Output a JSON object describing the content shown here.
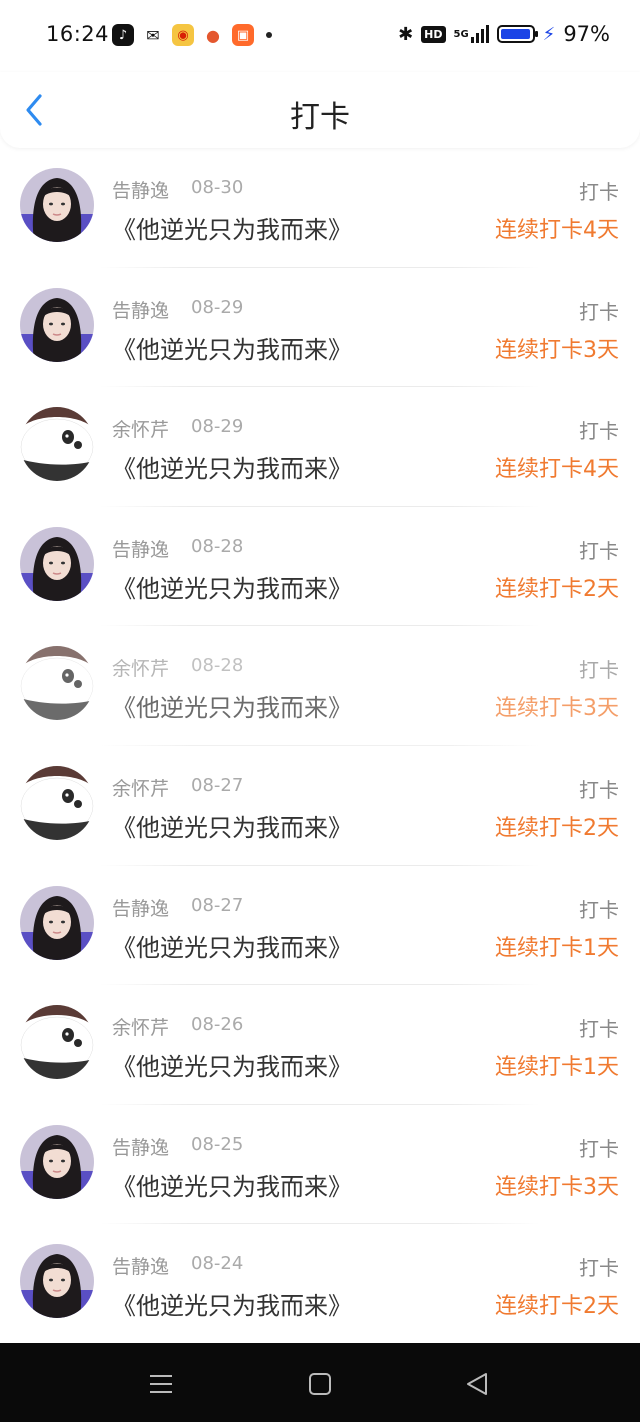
{
  "status": {
    "time": "16:24",
    "battery": "97%",
    "hd": "HD",
    "network": "5G",
    "battery_level": 0.97
  },
  "header": {
    "title": "打卡"
  },
  "items": [
    {
      "name": "告静逸",
      "date": "08-30",
      "book": "《他逆光只为我而来》",
      "type": "打卡",
      "streak": "连续打卡4天",
      "avatar": "girl"
    },
    {
      "name": "告静逸",
      "date": "08-29",
      "book": "《他逆光只为我而来》",
      "type": "打卡",
      "streak": "连续打卡3天",
      "avatar": "girl"
    },
    {
      "name": "余怀芹",
      "date": "08-29",
      "book": "《他逆光只为我而来》",
      "type": "打卡",
      "streak": "连续打卡4天",
      "avatar": "panda"
    },
    {
      "name": "告静逸",
      "date": "08-28",
      "book": "《他逆光只为我而来》",
      "type": "打卡",
      "streak": "连续打卡2天",
      "avatar": "girl"
    },
    {
      "name": "余怀芹",
      "date": "08-28",
      "book": "《他逆光只为我而来》",
      "type": "打卡",
      "streak": "连续打卡3天",
      "avatar": "panda"
    },
    {
      "name": "余怀芹",
      "date": "08-27",
      "book": "《他逆光只为我而来》",
      "type": "打卡",
      "streak": "连续打卡2天",
      "avatar": "panda"
    },
    {
      "name": "告静逸",
      "date": "08-27",
      "book": "《他逆光只为我而来》",
      "type": "打卡",
      "streak": "连续打卡1天",
      "avatar": "girl"
    },
    {
      "name": "余怀芹",
      "date": "08-26",
      "book": "《他逆光只为我而来》",
      "type": "打卡",
      "streak": "连续打卡1天",
      "avatar": "panda"
    },
    {
      "name": "告静逸",
      "date": "08-25",
      "book": "《他逆光只为我而来》",
      "type": "打卡",
      "streak": "连续打卡3天",
      "avatar": "girl"
    },
    {
      "name": "告静逸",
      "date": "08-24",
      "book": "《他逆光只为我而来》",
      "type": "打卡",
      "streak": "连续打卡2天",
      "avatar": "girl"
    }
  ],
  "icons": {
    "back": "chevron-left-icon",
    "nav_menu": "menu-icon",
    "nav_home": "home-square-icon",
    "nav_back": "triangle-back-icon"
  },
  "colors": {
    "accent_orange": "#f07a30",
    "back_blue": "#2e8bf0",
    "battery_blue": "#1b44e6"
  }
}
